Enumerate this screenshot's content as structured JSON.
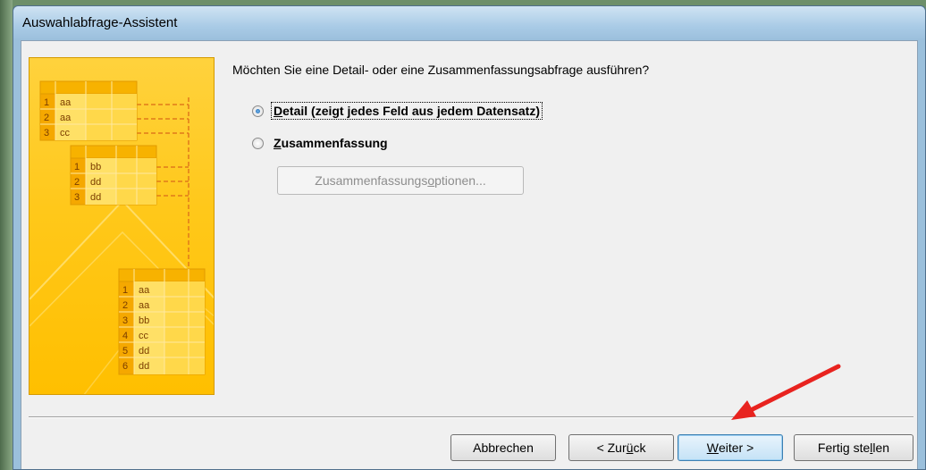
{
  "window": {
    "title": "Auswahlabfrage-Assistent"
  },
  "illustration": {
    "table1": [
      {
        "n": "1",
        "v": "aa"
      },
      {
        "n": "2",
        "v": "aa"
      },
      {
        "n": "3",
        "v": "cc"
      }
    ],
    "table2": [
      {
        "n": "1",
        "v": "bb"
      },
      {
        "n": "2",
        "v": "dd"
      },
      {
        "n": "3",
        "v": "dd"
      }
    ],
    "table3": [
      {
        "n": "1",
        "v": "aa"
      },
      {
        "n": "2",
        "v": "aa"
      },
      {
        "n": "3",
        "v": "bb"
      },
      {
        "n": "4",
        "v": "cc"
      },
      {
        "n": "5",
        "v": "dd"
      },
      {
        "n": "6",
        "v": "dd"
      }
    ]
  },
  "main": {
    "question": "Möchten Sie eine Detail- oder eine Zusammenfassungsabfrage ausführen?",
    "options": [
      {
        "label_mnemonic": "D",
        "label_rest": "etail (zeigt jedes Feld aus jedem Datensatz)",
        "checked": true
      },
      {
        "label_mnemonic": "Z",
        "label_rest": "usammenfassung",
        "checked": false
      }
    ],
    "summary_button": {
      "pre": "Zusammenfassungs",
      "mnemonic": "o",
      "post": "ptionen..."
    }
  },
  "buttons": {
    "cancel": "Abbrechen",
    "back": {
      "pre": "< Zur",
      "mnemonic": "ü",
      "post": "ck"
    },
    "next": {
      "pre": "",
      "mnemonic": "W",
      "post": "eiter >"
    },
    "finish": {
      "pre": "Fertig ste",
      "mnemonic": "l",
      "post": "len"
    }
  },
  "annotation": {
    "arrow_color": "#e8231f"
  }
}
